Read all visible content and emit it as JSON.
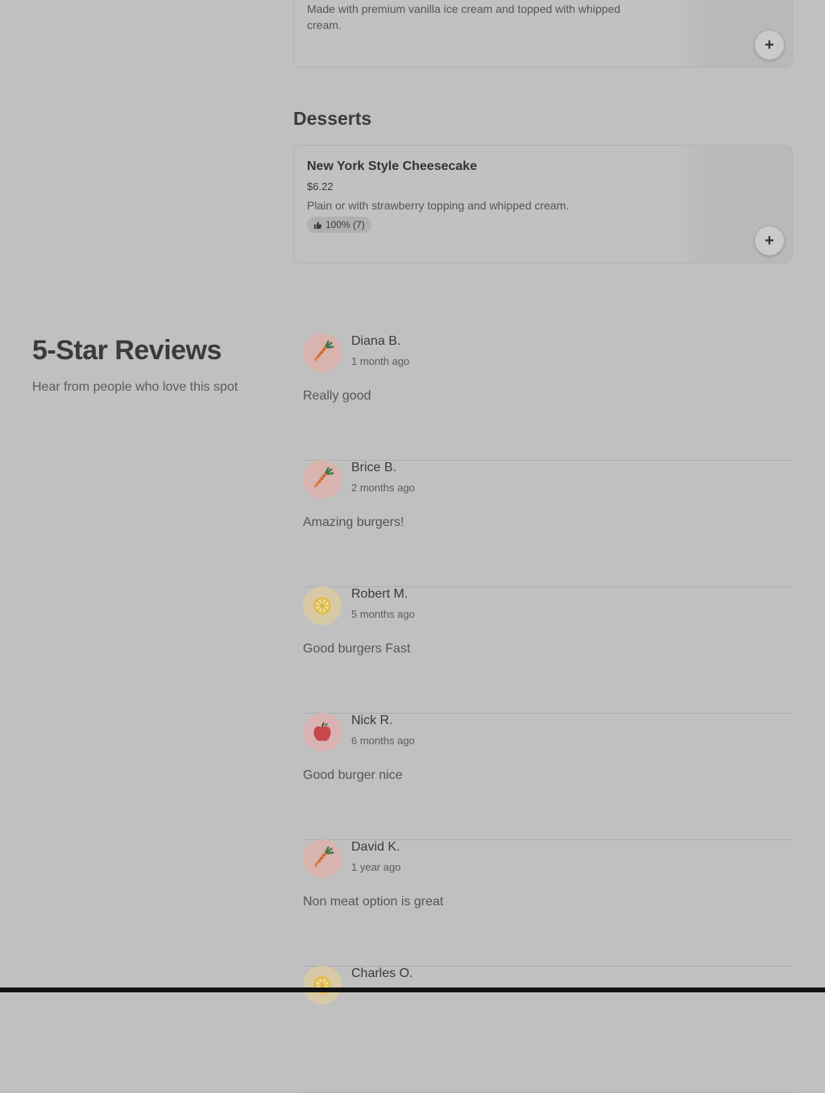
{
  "top_item": {
    "description": "Made with premium vanilla ice cream and topped with whipped cream.",
    "add_label": "+"
  },
  "desserts": {
    "section_title": "Desserts",
    "items": [
      {
        "name": "New York Style Cheesecake",
        "price": "$6.22",
        "description": "Plain or with strawberry topping and whipped cream.",
        "rating": "100% (7)",
        "add_label": "+"
      }
    ]
  },
  "reviews": {
    "title": "5-Star Reviews",
    "subtitle": "Hear from people who love this spot",
    "items": [
      {
        "name": "Diana B.",
        "date": "1 month ago",
        "text": "Really good",
        "avatar_icon": "carrot-icon",
        "avatar_bg": "#d9b3ad"
      },
      {
        "name": "Brice B.",
        "date": "2 months ago",
        "text": "Amazing burgers!",
        "avatar_icon": "carrot-icon",
        "avatar_bg": "#d9b3ad"
      },
      {
        "name": "Robert M.",
        "date": "5 months ago",
        "text": "Good burgers Fast",
        "avatar_icon": "lemon-icon",
        "avatar_bg": "#d8c9a6"
      },
      {
        "name": "Nick R.",
        "date": "6 months ago",
        "text": "Good burger nice",
        "avatar_icon": "apple-icon",
        "avatar_bg": "#d9b3b3"
      },
      {
        "name": "David K.",
        "date": "1 year ago",
        "text": "Non meat option is great",
        "avatar_icon": "carrot-icon",
        "avatar_bg": "#d9b3ad"
      },
      {
        "name": "Charles O.",
        "date": "",
        "text": "",
        "avatar_icon": "lemon-icon",
        "avatar_bg": "#d8c9a6"
      }
    ]
  }
}
